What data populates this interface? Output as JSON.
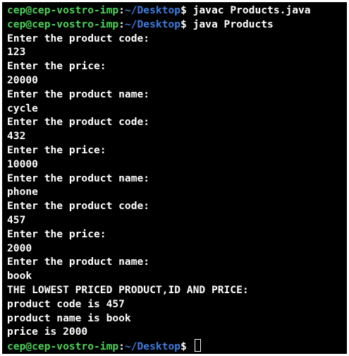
{
  "prompt": {
    "user_host": "cep@cep-vostro-imp",
    "separator": ":",
    "path": "~/Desktop",
    "dollar": "$ "
  },
  "commands": [
    "javac Products.java",
    "java Products"
  ],
  "output": [
    "Enter the product code:",
    "123",
    "Enter the price:",
    "20000",
    "Enter the product name:",
    "cycle",
    "Enter the product code:",
    "432",
    "Enter the price:",
    "10000",
    "Enter the product name:",
    "phone",
    "Enter the product code:",
    "457",
    "Enter the price:",
    "2000",
    "Enter the product name:",
    "book",
    "THE LOWEST PRICED PRODUCT,ID AND PRICE:",
    "product code is 457",
    "product name is book",
    "price is 2000"
  ],
  "colors": {
    "background": "#000000",
    "user_host": "#4fd35a",
    "path": "#3f7de0",
    "text": "#ffffff"
  }
}
